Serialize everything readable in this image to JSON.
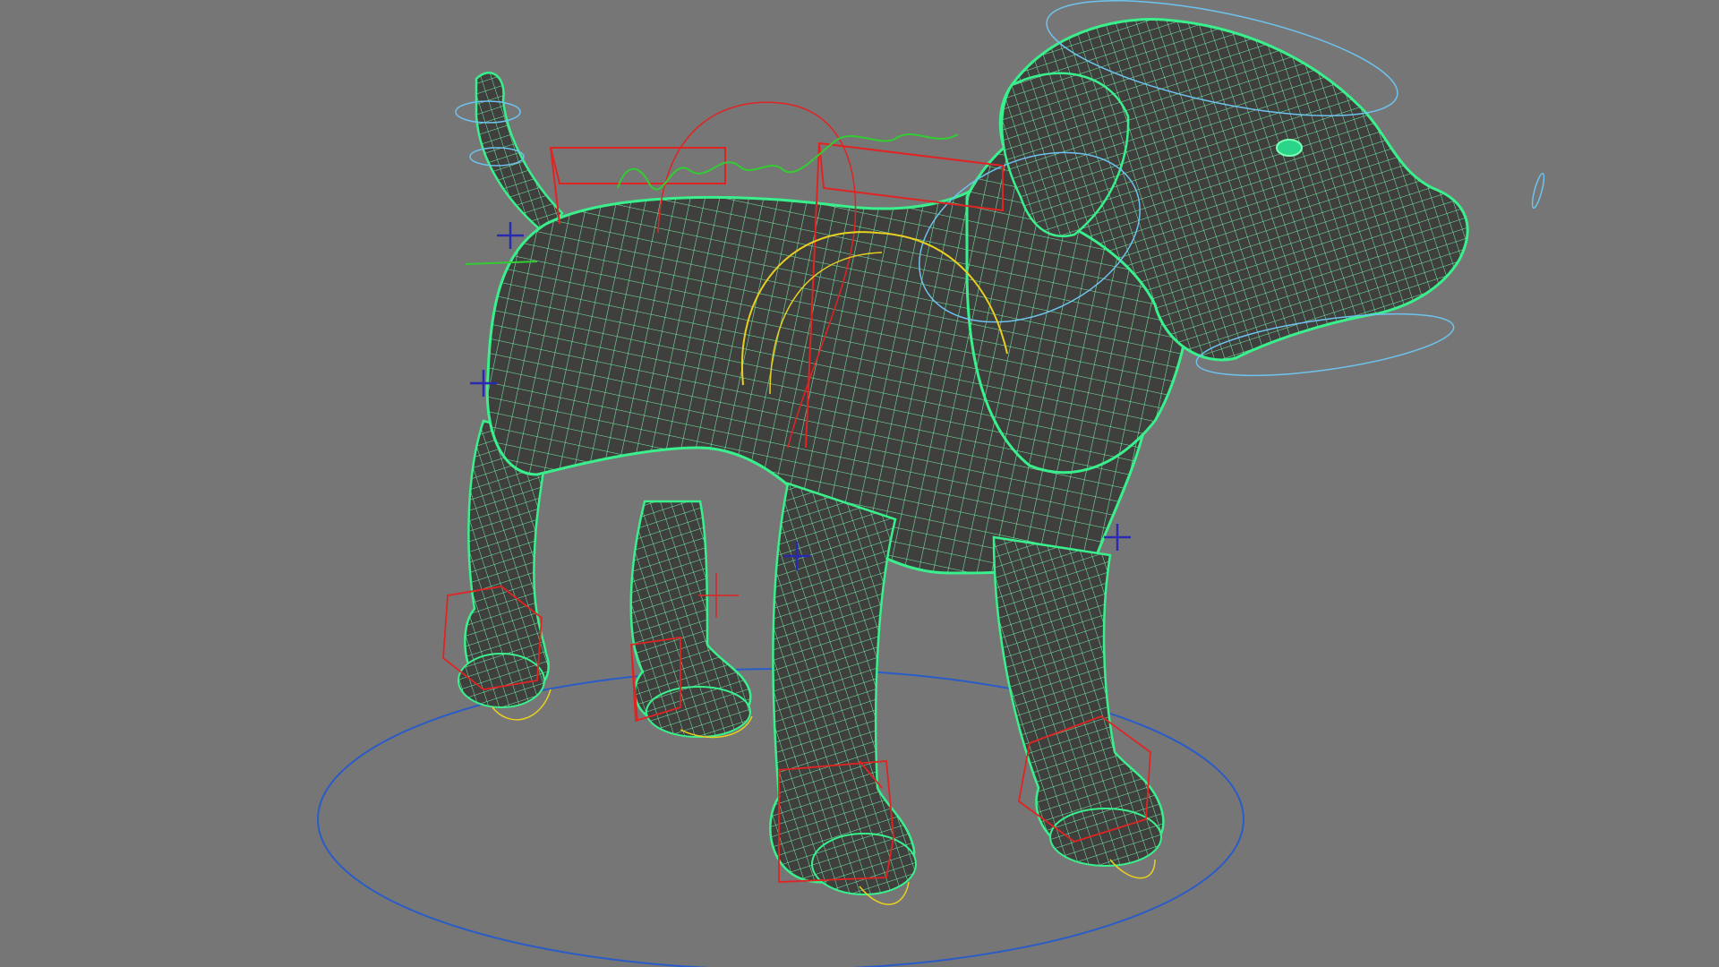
{
  "viewport": {
    "background_color": "#767676",
    "model": {
      "description_icon": "dog-model-icon",
      "body_color": "#3f403e",
      "wireframe_color": "#7dffb4",
      "wireframe_outline_color": "#39f08c"
    },
    "rig": {
      "ground_control_color": "#2a5cc8",
      "ik_box_color": "#e02424",
      "spine_curve_color": "#33cc33",
      "fk_curve_color": "#e8d020",
      "head_control_color": "#6ec3ee",
      "locator_color": "#2a2ab0"
    }
  }
}
